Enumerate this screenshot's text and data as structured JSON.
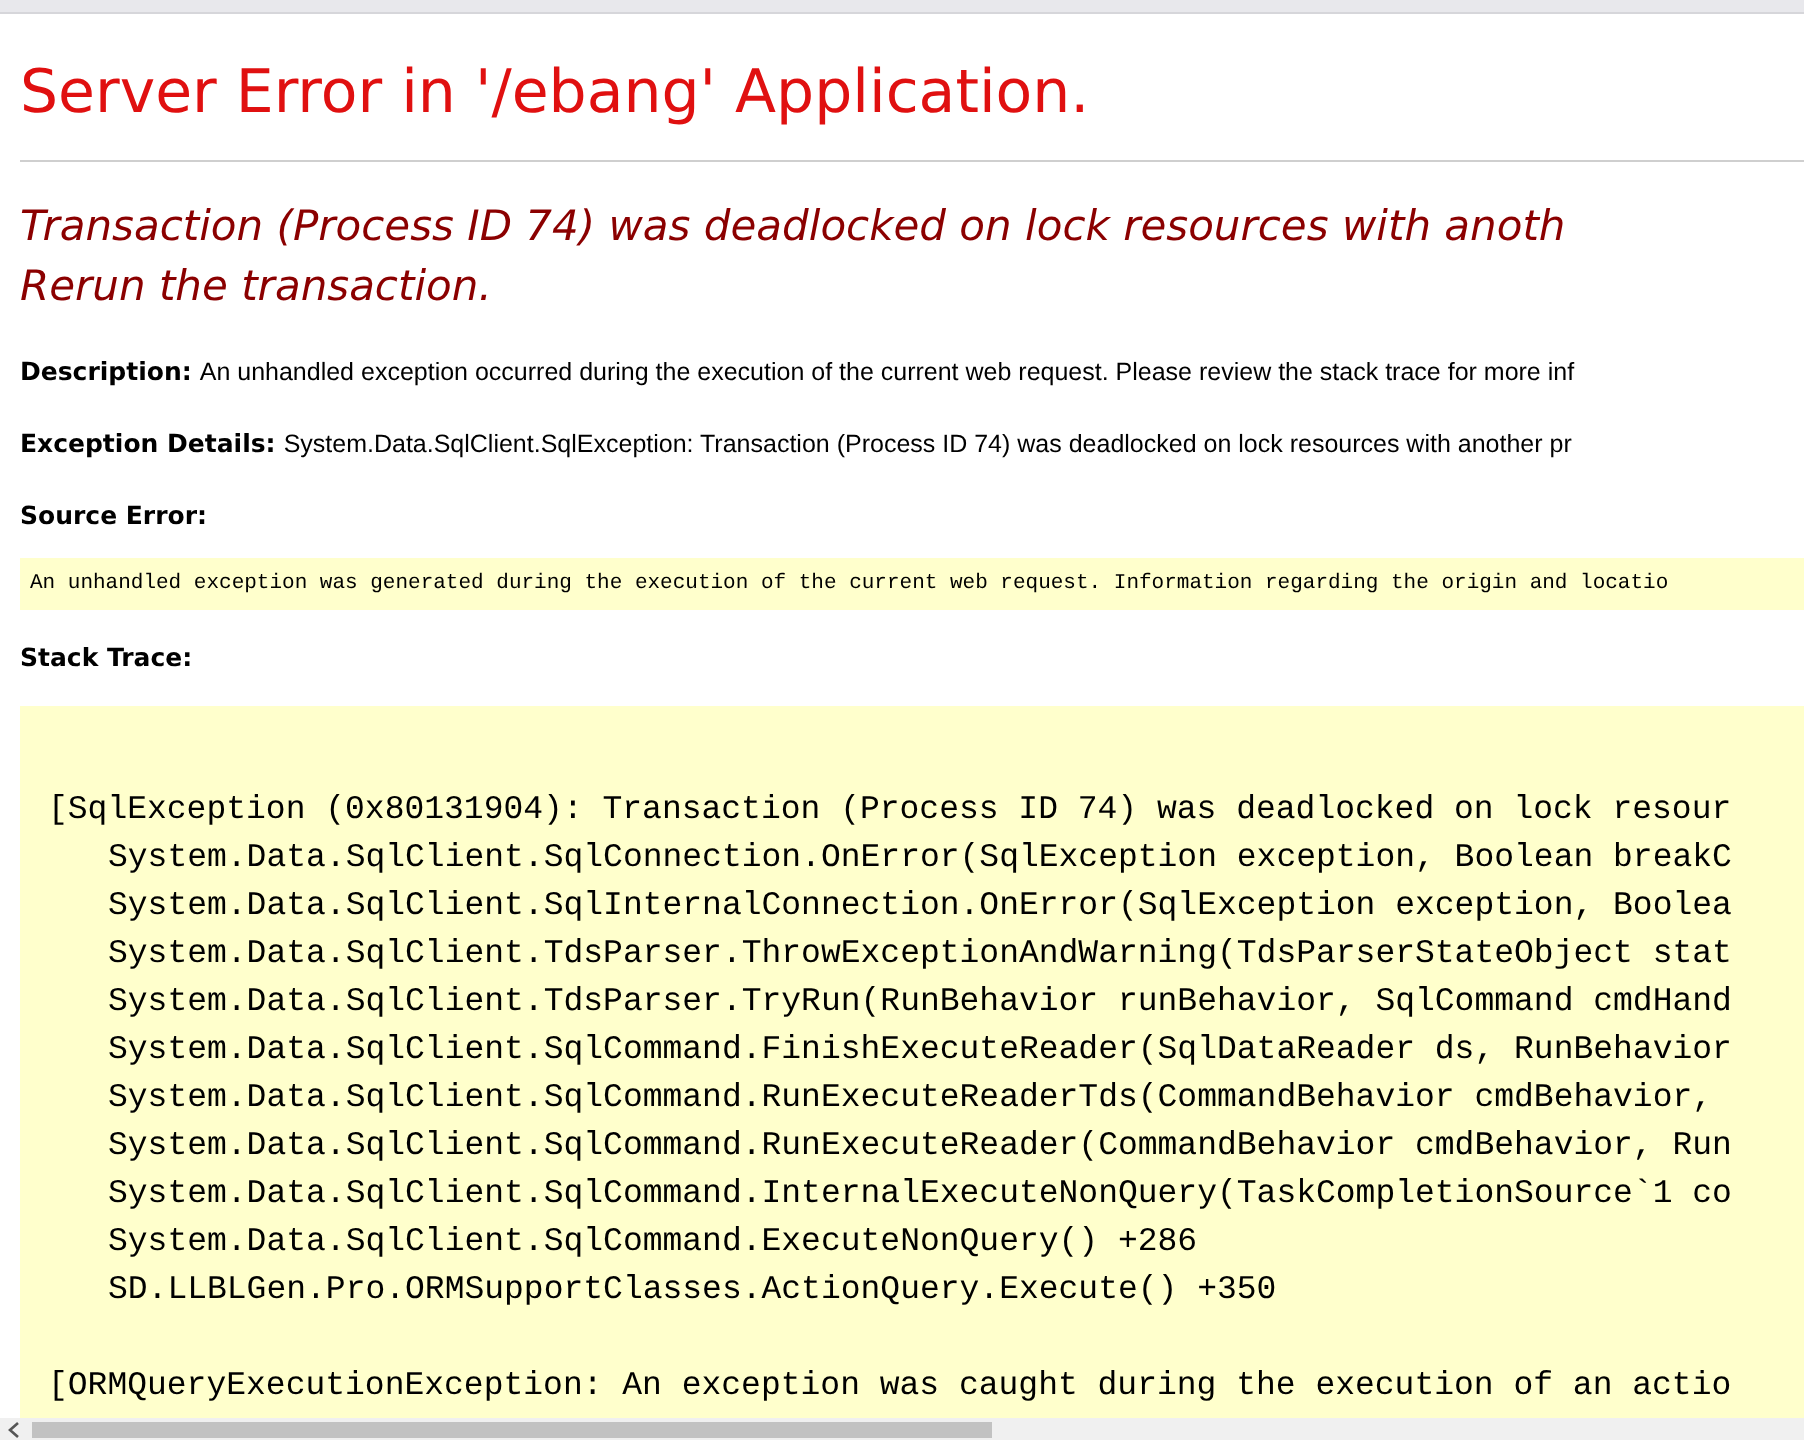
{
  "title": "Server Error in '/ebang' Application.",
  "message": [
    "Transaction (Process ID 74) was deadlocked on lock resources with anoth",
    "Rerun the transaction."
  ],
  "description": {
    "label": "Description:",
    "text": "An unhandled exception occurred during the execution of the current web request. Please review the stack trace for more inf"
  },
  "exception_details": {
    "label": "Exception Details:",
    "text": "System.Data.SqlClient.SqlException: Transaction (Process ID 74) was deadlocked on lock resources with another pr"
  },
  "source_error": {
    "label": "Source Error:",
    "text": "An unhandled exception was generated during the execution of the current web request. Information regarding the origin and locatio"
  },
  "stack_trace": {
    "label": "Stack Trace:",
    "lines": [
      {
        "kind": "exception",
        "text": "[SqlException (0x80131904): Transaction (Process ID 74) was deadlocked on lock resour"
      },
      {
        "kind": "frame",
        "text": "System.Data.SqlClient.SqlConnection.OnError(SqlException exception, Boolean breakC"
      },
      {
        "kind": "frame",
        "text": "System.Data.SqlClient.SqlInternalConnection.OnError(SqlException exception, Boolea"
      },
      {
        "kind": "frame",
        "text": "System.Data.SqlClient.TdsParser.ThrowExceptionAndWarning(TdsParserStateObject stat"
      },
      {
        "kind": "frame",
        "text": "System.Data.SqlClient.TdsParser.TryRun(RunBehavior runBehavior, SqlCommand cmdHand"
      },
      {
        "kind": "frame",
        "text": "System.Data.SqlClient.SqlCommand.FinishExecuteReader(SqlDataReader ds, RunBehavior"
      },
      {
        "kind": "frame",
        "text": "System.Data.SqlClient.SqlCommand.RunExecuteReaderTds(CommandBehavior cmdBehavior,"
      },
      {
        "kind": "frame",
        "text": "System.Data.SqlClient.SqlCommand.RunExecuteReader(CommandBehavior cmdBehavior, Run"
      },
      {
        "kind": "frame",
        "text": "System.Data.SqlClient.SqlCommand.InternalExecuteNonQuery(TaskCompletionSource`1 co"
      },
      {
        "kind": "frame",
        "text": "System.Data.SqlClient.SqlCommand.ExecuteNonQuery() +286"
      },
      {
        "kind": "frame",
        "text": "SD.LLBLGen.Pro.ORMSupportClasses.ActionQuery.Execute() +350"
      },
      {
        "kind": "exception",
        "text": "[ORMQueryExecutionException: An exception was caught during the execution of an actio"
      }
    ]
  }
}
